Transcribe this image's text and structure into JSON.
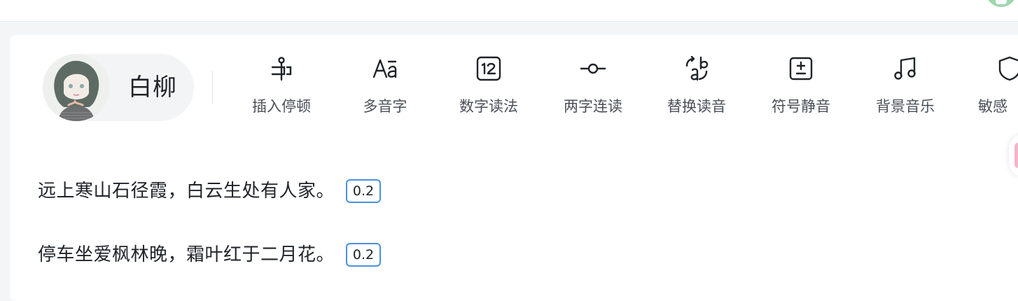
{
  "speaker": {
    "name": "白柳"
  },
  "toolbar": {
    "items": [
      {
        "label": "插入停顿",
        "icon": "insert-pause-icon"
      },
      {
        "label": "多音字",
        "icon": "polyphone-icon"
      },
      {
        "label": "数字读法",
        "icon": "number-reading-icon"
      },
      {
        "label": "两字连读",
        "icon": "two-char-link-icon"
      },
      {
        "label": "替换读音",
        "icon": "replace-pronunciation-icon"
      },
      {
        "label": "符号静音",
        "icon": "symbol-mute-icon"
      },
      {
        "label": "背景音乐",
        "icon": "background-music-icon"
      },
      {
        "label": "敏感",
        "icon": "sensitive-shield-icon"
      }
    ]
  },
  "editor": {
    "lines": [
      {
        "text": "远上寒山石径霞，白云生处有人家。",
        "pause": "0.2"
      },
      {
        "text": "停车坐爱枫林晚，霜叶红于二月花。",
        "pause": "0.2"
      }
    ]
  },
  "colors": {
    "accent": "#4a90e2",
    "text": "#1f2329",
    "muted": "#4b5059"
  }
}
